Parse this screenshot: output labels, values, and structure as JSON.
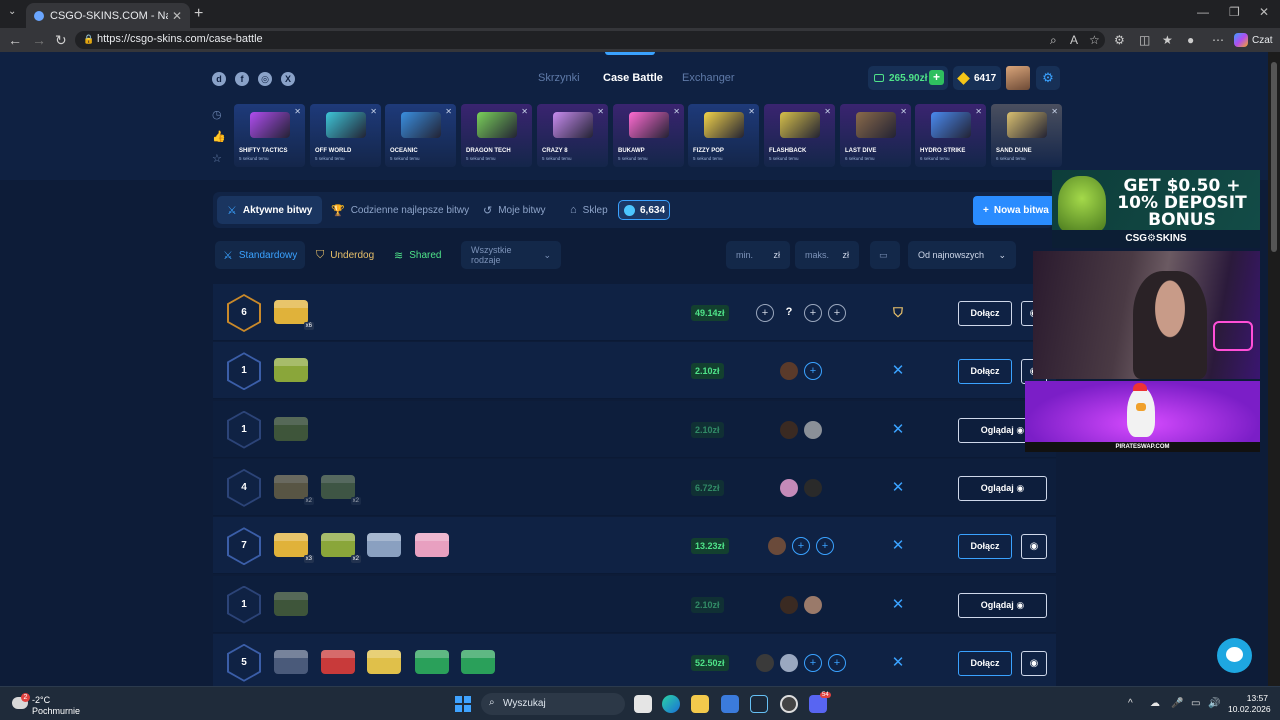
{
  "browser": {
    "tab_title": "CSGO-SKINS.COM - Najlepsze Sk",
    "url": "https://csgo-skins.com/case-battle",
    "chat_label": "Czat"
  },
  "header": {
    "nav": [
      "Skrzynki",
      "Case Battle",
      "Exchanger"
    ],
    "balance": "265.90zł",
    "coins": "6417"
  },
  "cases": [
    {
      "name": "SHIFTY TACTICS",
      "sub": "5 sekund temu",
      "color": "#1e3a7a",
      "img": "#b04df0"
    },
    {
      "name": "OFF WORLD",
      "sub": "5 sekund temu",
      "color": "#1e3a7a",
      "img": "#3ec6d8"
    },
    {
      "name": "OCEANIC",
      "sub": "5 sekund temu",
      "color": "#1e3a7a",
      "img": "#3a8fe0"
    },
    {
      "name": "DRAGON TECH",
      "sub": "5 sekund temu",
      "color": "#3a2470",
      "img": "#7ad05a"
    },
    {
      "name": "CRAZY 8",
      "sub": "5 sekund temu",
      "color": "#3a2470",
      "img": "#c88cf0"
    },
    {
      "name": "BUKAWP",
      "sub": "5 sekund temu",
      "color": "#3a2470",
      "img": "#ff6bd2"
    },
    {
      "name": "FIZZY POP",
      "sub": "5 sekund temu",
      "color": "#1e3a7a",
      "img": "#f2d34a"
    },
    {
      "name": "FLASHBACK",
      "sub": "5 sekund temu",
      "color": "#3a2470",
      "img": "#d6c04a"
    },
    {
      "name": "LAST DIVE",
      "sub": "6 sekund temu",
      "color": "#3a2470",
      "img": "#8a6a4a"
    },
    {
      "name": "HYDRO STRIKE",
      "sub": "6 sekund temu",
      "color": "#3a2470",
      "img": "#4a8af0"
    },
    {
      "name": "SAND DUNE",
      "sub": "6 sekund temu",
      "color": "#4a4f5f",
      "img": "#d9c070"
    }
  ],
  "tabs": {
    "active": "Aktywne bitwy",
    "daily": "Codzienne najlepsze bitwy",
    "mine": "Moje bitwy",
    "shop": "Sklep",
    "gems": "6,634",
    "new_battle": "Nowa bitwa"
  },
  "filters": {
    "standard": "Standardowy",
    "underdog": "Underdog",
    "shared": "Shared",
    "all_types": "Wszystkie rodzaje",
    "min": "min.",
    "max": "maks.",
    "currency": "zł",
    "sort": "Od najnowszych"
  },
  "battles": [
    {
      "rounds": "6",
      "price": "49.14zł",
      "mode": "underdog",
      "action": "Dołącz",
      "hex": "#c9892a",
      "boxes": [
        {
          "color": "#e0b23a",
          "mul": "x6"
        }
      ],
      "players": [
        "plus",
        "q",
        "plus",
        "plus"
      ],
      "dim": false
    },
    {
      "rounds": "1",
      "price": "2.10zł",
      "mode": "standard",
      "action": "Dołącz",
      "hex": "#3b5ea8",
      "boxes": [
        {
          "color": "#8aa63a",
          "mul": ""
        }
      ],
      "players": [
        "avatar:#5a3a2a",
        "blue"
      ],
      "dim": false
    },
    {
      "rounds": "1",
      "price": "2.10zł",
      "mode": "standard",
      "action": "Oglądaj",
      "hex": "#2c4478",
      "boxes": [
        {
          "color": "#5f7a3a",
          "mul": ""
        }
      ],
      "players": [
        "avatar:#3a2a22",
        "avatar:#8a9098"
      ],
      "dim": true
    },
    {
      "rounds": "4",
      "price": "6.72zł",
      "mode": "standard",
      "action": "Oglądaj",
      "hex": "#2c4478",
      "boxes": [
        {
          "color": "#8a7a4a",
          "mul": "x2"
        },
        {
          "color": "#5f7a4a",
          "mul": "x2"
        }
      ],
      "players": [
        "avatar:#c48ab8",
        "avatar:#2a2a2a"
      ],
      "dim": true
    },
    {
      "rounds": "7",
      "price": "13.23zł",
      "mode": "standard",
      "action": "Dołącz",
      "hex": "#3b5ea8",
      "boxes": [
        {
          "color": "#e0b23a",
          "mul": "x3"
        },
        {
          "color": "#8aa63a",
          "mul": "x2"
        },
        {
          "color": "#8aa0c0",
          "mul": ""
        },
        {
          "color": "#e8a0c0",
          "mul": ""
        }
      ],
      "players": [
        "avatar:#6a4a3a",
        "blue",
        "blue"
      ],
      "dim": false
    },
    {
      "rounds": "1",
      "price": "2.10zł",
      "mode": "standard",
      "action": "Oglądaj",
      "hex": "#2c4478",
      "boxes": [
        {
          "color": "#5f7a3a",
          "mul": ""
        }
      ],
      "players": [
        "avatar:#3a2a22",
        "avatar:#9a7a6a"
      ],
      "dim": true
    },
    {
      "rounds": "5",
      "price": "52.50zł",
      "mode": "standard",
      "action": "Dołącz",
      "hex": "#3b5ea8",
      "boxes": [
        {
          "color": "#4a5a7a",
          "mul": ""
        },
        {
          "color": "#c83a3a",
          "mul": ""
        },
        {
          "color": "#e0c04a",
          "mul": ""
        },
        {
          "color": "#2aa05a",
          "mul": ""
        },
        {
          "color": "#2aa05a",
          "mul": ""
        }
      ],
      "players": [
        "avatar:#3a3a3a",
        "avatar:#9aa8c0",
        "blue",
        "blue"
      ],
      "dim": false
    }
  ],
  "ad": {
    "headline": "GET $0.50 + 10% DEPOSIT BONUS",
    "brand": "CSG⚙SKINS",
    "caption": "PIRATESWAP.COM"
  },
  "taskbar": {
    "temp": "-2°C",
    "weather": "Pochmurnie",
    "search": "Wyszukaj",
    "time": "13:57",
    "date": "10.02.2026",
    "notif": "2",
    "discord_badge": "54"
  }
}
